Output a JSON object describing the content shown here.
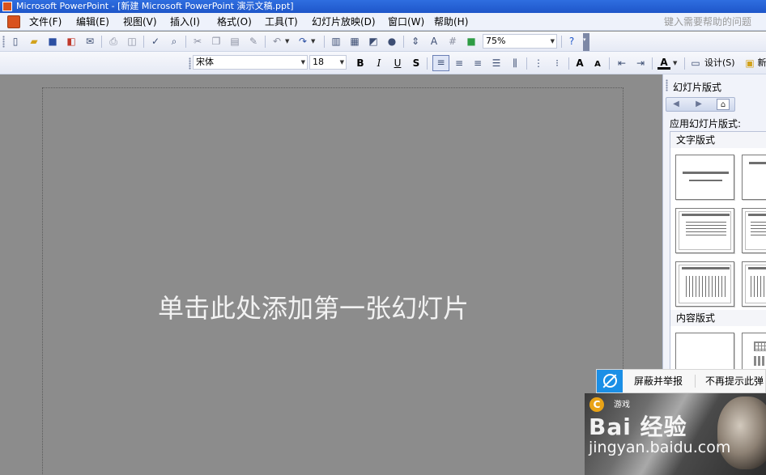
{
  "window": {
    "title": "Microsoft PowerPoint - [新建 Microsoft PowerPoint 演示文稿.ppt]"
  },
  "menubar": {
    "items": [
      "文件(F)",
      "编辑(E)",
      "视图(V)",
      "插入(I)",
      "格式(O)",
      "工具(T)",
      "幻灯片放映(D)",
      "窗口(W)",
      "帮助(H)"
    ],
    "help_placeholder": "键入需要帮助的问题"
  },
  "toolbar_standard": {
    "zoom": "75%"
  },
  "toolbar_formatting": {
    "font_name": "宋体",
    "font_size": "18",
    "bold": "B",
    "italic": "I",
    "underline": "U",
    "shadow": "S",
    "font_color": "A",
    "design_label": "设计(S)",
    "new_slide_label": "新"
  },
  "slide": {
    "prompt": "单击此处添加第一张幻灯片"
  },
  "taskpane": {
    "title": "幻灯片版式",
    "apply_label": "应用幻灯片版式:",
    "section_text": "文字版式",
    "section_content": "内容版式"
  },
  "report_bar": {
    "block_report": "屏蔽并举报",
    "no_more": "不再提示此弹"
  },
  "overlay": {
    "game_label": "游戏",
    "watermark_logo": "Bai 经验",
    "watermark_url": "jingyan.baidu.com"
  },
  "colors": {
    "titlebar": "#2f6ee0",
    "workspace": "#8c8c8c",
    "report_icon": "#1b8fe6"
  }
}
